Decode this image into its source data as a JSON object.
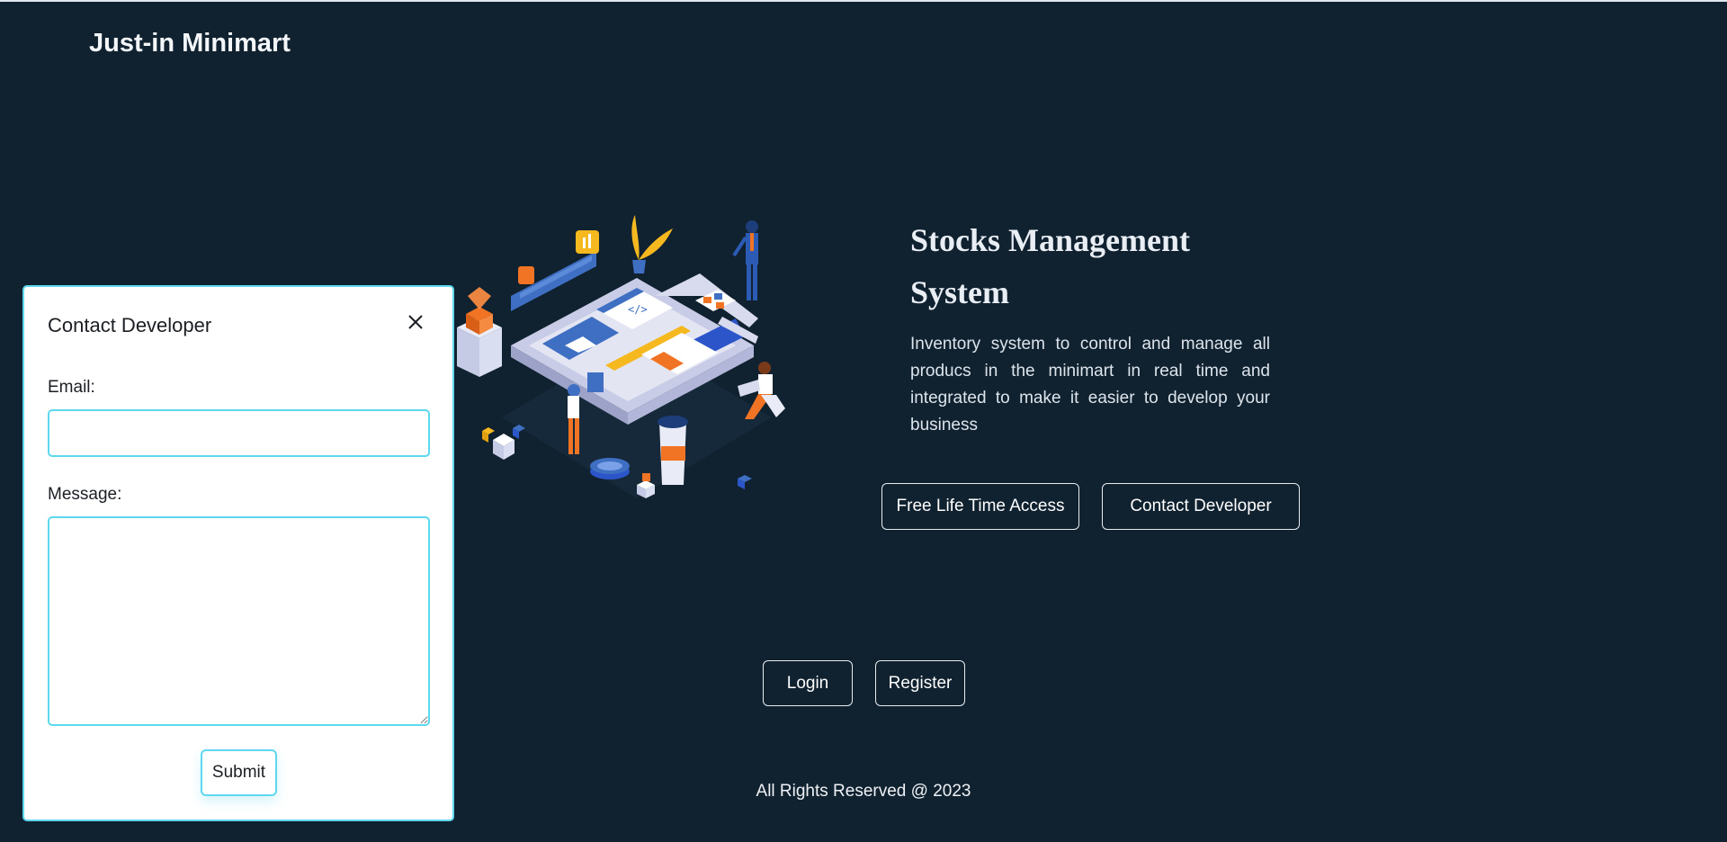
{
  "brand": "Just-in Minimart",
  "hero": {
    "title": "Stocks Management System",
    "description": "Inventory system to control and manage all producs in the minimart in real time and integrated to make it easier to develop your business",
    "illustration_icon": "isometric-inventory-illustration"
  },
  "buttons": {
    "free_access": "Free Life Time Access",
    "contact_developer": "Contact Developer",
    "login": "Login",
    "register": "Register"
  },
  "footer": "All Rights Reserved @ 2023",
  "modal": {
    "title": "Contact Developer",
    "close_icon": "close-icon",
    "email_label": "Email:",
    "email_value": "",
    "message_label": "Message:",
    "message_value": "",
    "submit_label": "Submit"
  },
  "colors": {
    "background": "#10212f",
    "accent_border": "#5ed8ee",
    "orange": "#f07424",
    "blue": "#3e6fc2",
    "yellow": "#f6b81f"
  }
}
